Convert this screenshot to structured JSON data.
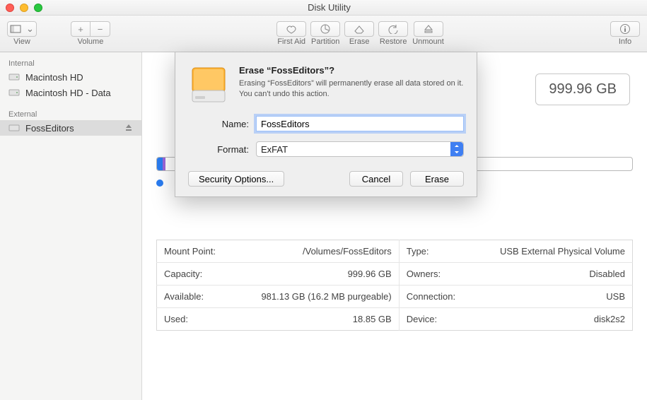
{
  "window": {
    "title": "Disk Utility"
  },
  "toolbar": {
    "view": "View",
    "volume": "Volume",
    "first_aid": "First Aid",
    "partition": "Partition",
    "erase": "Erase",
    "restore": "Restore",
    "unmount": "Unmount",
    "info": "Info"
  },
  "sidebar": {
    "internal_hdr": "Internal",
    "internal": [
      {
        "label": "Macintosh HD"
      },
      {
        "label": "Macintosh HD - Data"
      }
    ],
    "external_hdr": "External",
    "external": [
      {
        "label": "FossEditors"
      }
    ]
  },
  "capacity_badge": "999.96 GB",
  "sheet": {
    "title": "Erase “FossEditors”?",
    "body": "Erasing “FossEditors” will permanently erase all data stored on it. You can't undo this action.",
    "name_label": "Name:",
    "name_value": "FossEditors",
    "format_label": "Format:",
    "format_value": "ExFAT",
    "security_btn": "Security Options...",
    "cancel_btn": "Cancel",
    "erase_btn": "Erase"
  },
  "info": {
    "mount_point_k": "Mount Point:",
    "mount_point_v": "/Volumes/FossEditors",
    "capacity_k": "Capacity:",
    "capacity_v": "999.96 GB",
    "available_k": "Available:",
    "available_v": "981.13 GB (16.2 MB purgeable)",
    "used_k": "Used:",
    "used_v": "18.85 GB",
    "type_k": "Type:",
    "type_v": "USB External Physical Volume",
    "owners_k": "Owners:",
    "owners_v": "Disabled",
    "connection_k": "Connection:",
    "connection_v": "USB",
    "device_k": "Device:",
    "device_v": "disk2s2"
  }
}
